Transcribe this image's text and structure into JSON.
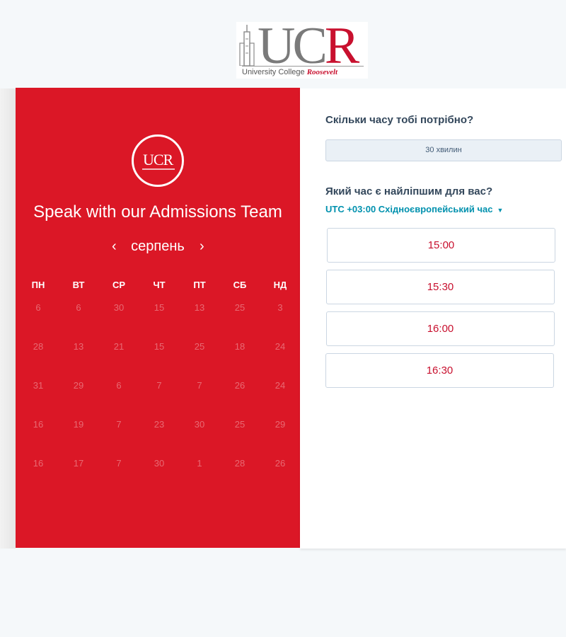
{
  "header": {
    "logo_text": "UCR",
    "logo_subtitle_part1": "University College ",
    "logo_subtitle_part2": "Roosevelt"
  },
  "left": {
    "badge_text": "UCR",
    "title": "Speak with our Admissions Team",
    "month": "серпень",
    "prev_icon": "chevron-left-icon",
    "next_icon": "chevron-right-icon",
    "weekdays": [
      "ПН",
      "ВТ",
      "СР",
      "ЧТ",
      "ПТ",
      "СБ",
      "НД"
    ],
    "weeks": [
      [
        "6",
        "6",
        "30",
        "15",
        "13",
        "25",
        "3"
      ],
      [
        "28",
        "13",
        "21",
        "15",
        "25",
        "18",
        "24"
      ],
      [
        "31",
        "29",
        "6",
        "7",
        "7",
        "26",
        "24"
      ],
      [
        "16",
        "19",
        "7",
        "23",
        "30",
        "25",
        "29"
      ],
      [
        "16",
        "17",
        "7",
        "30",
        "1",
        "28",
        "26"
      ]
    ]
  },
  "right": {
    "duration_question": "Скільки часу тобі потрібно?",
    "duration_value": "30 хвилин",
    "time_question": "Який час є найліпшим для вас?",
    "timezone": "UTC +03:00 Східноєвропейський час",
    "slots": [
      "15:00",
      "15:30",
      "16:00",
      "16:30"
    ]
  },
  "colors": {
    "brand_red": "#db1726",
    "accent_teal": "#0091ae",
    "slot_text": "#c8102e"
  }
}
